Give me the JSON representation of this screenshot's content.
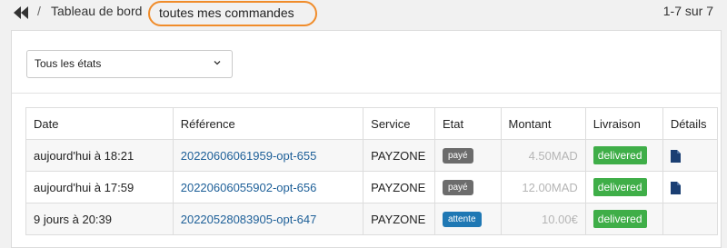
{
  "breadcrumb": {
    "separator": "/",
    "parent_label": "Tableau de bord",
    "current_label": "toutes mes commandes"
  },
  "pager_text": "1-7 sur 7",
  "filter": {
    "selected": "Tous les états"
  },
  "table": {
    "headers": {
      "date": "Date",
      "reference": "Référence",
      "service": "Service",
      "etat": "Etat",
      "montant": "Montant",
      "livraison": "Livraison",
      "details": "Détails"
    },
    "rows": [
      {
        "date": "aujourd'hui à 18:21",
        "reference": "20220606061959-opt-655",
        "service": "PAYZONE",
        "etat": "payé",
        "etat_color": "#6c6c6c",
        "montant": "4.50MAD",
        "livraison": "delivered",
        "has_details": true
      },
      {
        "date": "aujourd'hui à 17:59",
        "reference": "20220606055902-opt-656",
        "service": "PAYZONE",
        "etat": "payé",
        "etat_color": "#6c6c6c",
        "montant": "12.00MAD",
        "livraison": "delivered",
        "has_details": true
      },
      {
        "date": "9 jours à 20:39",
        "reference": "20220528083905-opt-647",
        "service": "PAYZONE",
        "etat": "attente",
        "etat_color": "#1f78b4",
        "montant": "10.00€",
        "livraison": "delivered",
        "has_details": false
      }
    ]
  },
  "colors": {
    "accent_highlight": "#f08c2a",
    "link": "#1d5f98",
    "delivered_badge": "#3fae48",
    "icon": "#1b3f73"
  },
  "icons": {
    "back": "double-left-arrow-icon",
    "select_caret": "chevron-down-icon",
    "details": "document-icon"
  }
}
